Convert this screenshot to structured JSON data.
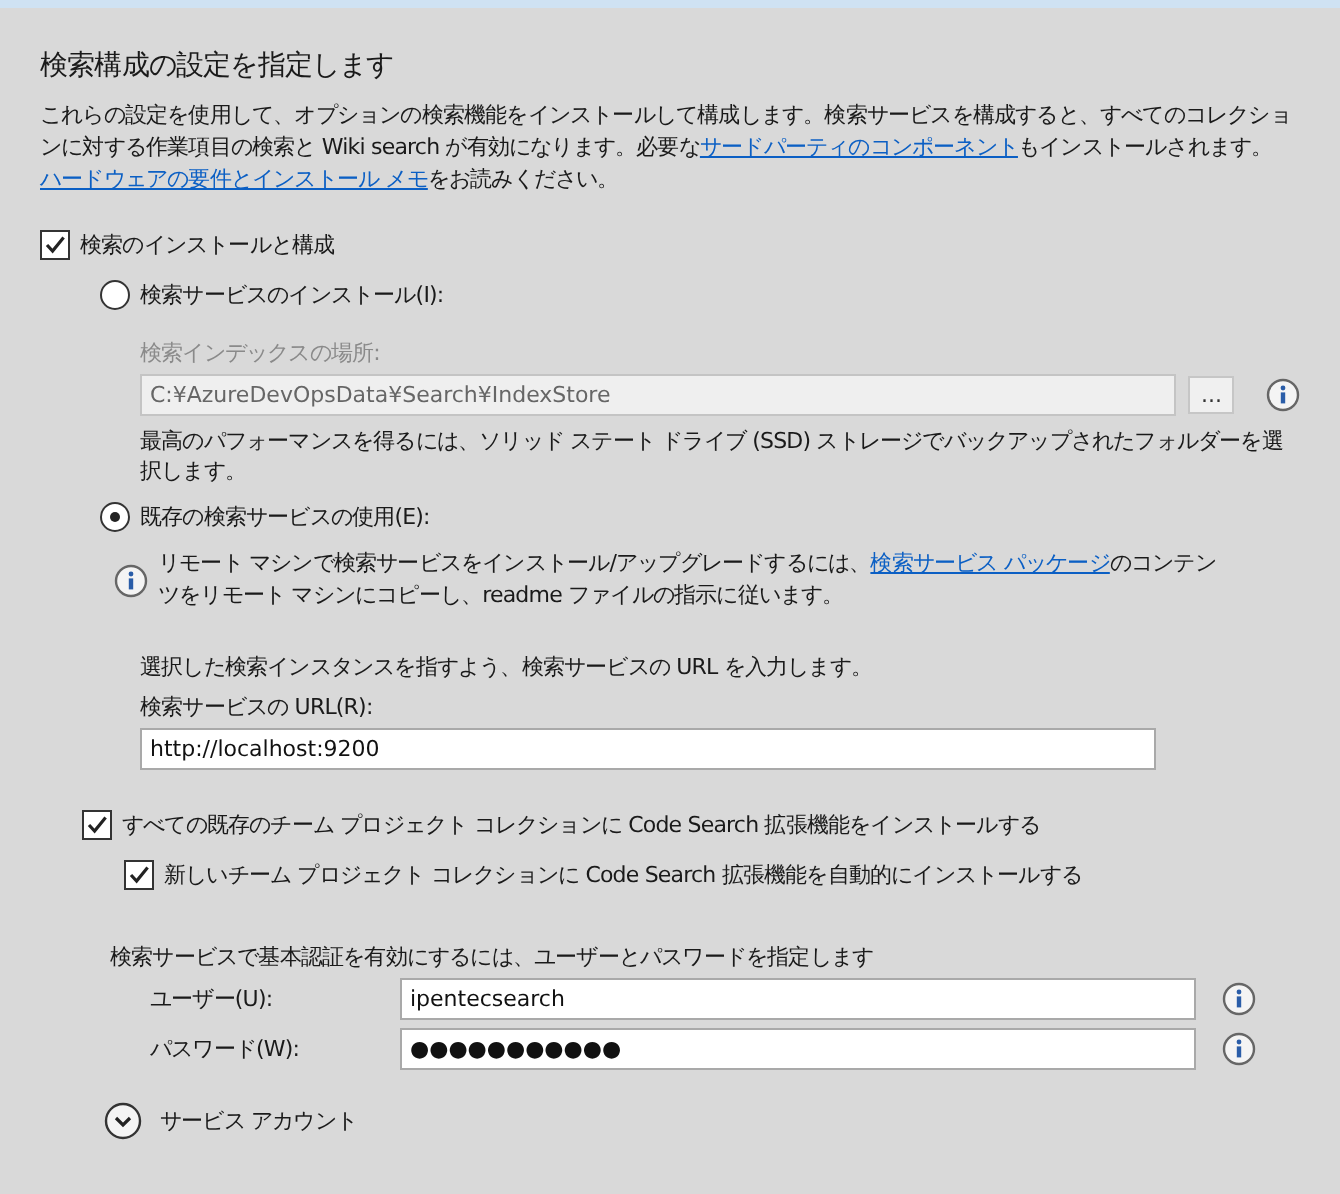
{
  "title": "検索構成の設定を指定します",
  "description": [
    {
      "kind": "text",
      "text": "これらの設定を使用して、オプションの検索機能をインストールして構成します。検索サービスを構成すると、すべてのコレクションに対する作業項目の検索と Wiki search が有効になります。必要な"
    },
    {
      "kind": "link",
      "text": "サードパーティのコンポーネント"
    },
    {
      "kind": "text",
      "text": "もインストールされます。"
    },
    {
      "kind": "link",
      "text": "ハードウェアの要件とインストール メモ"
    },
    {
      "kind": "text",
      "text": "をお読みください。"
    }
  ],
  "install_search": {
    "label": "検索のインストールと構成",
    "checked": true
  },
  "options": [
    {
      "label": "検索サービスのインストール(I):",
      "selected": false,
      "index_location": {
        "label": "検索インデックスの場所:",
        "value": "C:¥AzureDevOpsData¥Search¥IndexStore",
        "browse": "...",
        "disabled": true
      },
      "hint": "最高のパフォーマンスを得るには、ソリッド ステート ドライブ (SSD) ストレージでバックアップされたフォルダーを選択します。"
    },
    {
      "label": "既存の検索サービスの使用(E):",
      "selected": true,
      "info": [
        {
          "kind": "text",
          "text": "リモート マシンで検索サービスをインストール/アップグレードするには、"
        },
        {
          "kind": "link",
          "text": "検索サービス パッケージ"
        },
        {
          "kind": "text",
          "text": "のコンテンツをリモート マシンにコピーし、readme ファイルの指示に従います。"
        }
      ],
      "url_hint": "選択した検索インスタンスを指すよう、検索サービスの URL を入力します。",
      "url_label": "検索サービスの URL(R):",
      "url_value": "http://localhost:9200"
    }
  ],
  "extensions": [
    {
      "label": "すべての既存のチーム プロジェクト コレクションに Code Search 拡張機能をインストールする",
      "checked": true
    },
    {
      "label": "新しいチーム プロジェクト コレクションに Code Search 拡張機能を自動的にインストールする",
      "checked": true
    }
  ],
  "auth": {
    "label": "検索サービスで基本認証を有効にするには、ユーザーとパスワードを指定します",
    "fields": [
      {
        "label": "ユーザー(U):",
        "value": "ipentecsearch"
      },
      {
        "label": "パスワード(W):",
        "value": "●●●●●●●●●●●"
      }
    ]
  },
  "service_account": {
    "label": "サービス アカウント",
    "expanded": false
  }
}
